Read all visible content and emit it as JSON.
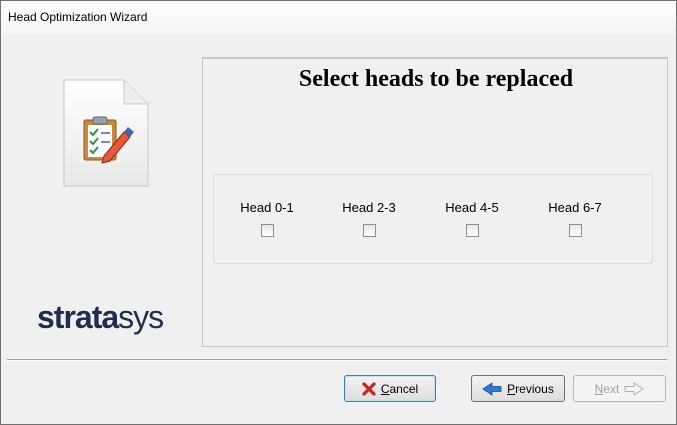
{
  "window": {
    "title": "Head Optimization Wizard"
  },
  "left_panel": {
    "icon": "clipboard-edit-document-icon",
    "logo": {
      "bold": "strata",
      "light": "sys"
    }
  },
  "main": {
    "heading": "Select heads to be replaced",
    "heads": [
      {
        "label": "Head 0-1",
        "checked": false
      },
      {
        "label": "Head 2-3",
        "checked": false
      },
      {
        "label": "Head 4-5",
        "checked": false
      },
      {
        "label": "Head 6-7",
        "checked": false
      }
    ]
  },
  "buttons": {
    "cancel": {
      "label": "Cancel",
      "icon": "red-x-icon",
      "enabled": true
    },
    "previous": {
      "label": "Previous",
      "icon": "blue-left-arrow-icon",
      "enabled": true
    },
    "next": {
      "label": "Next",
      "icon": "right-arrow-outline-icon",
      "enabled": false
    }
  },
  "colors": {
    "logo": "#1f2e4d",
    "cancel_icon": "#cc2222",
    "previous_arrow": "#2a7bd6"
  }
}
